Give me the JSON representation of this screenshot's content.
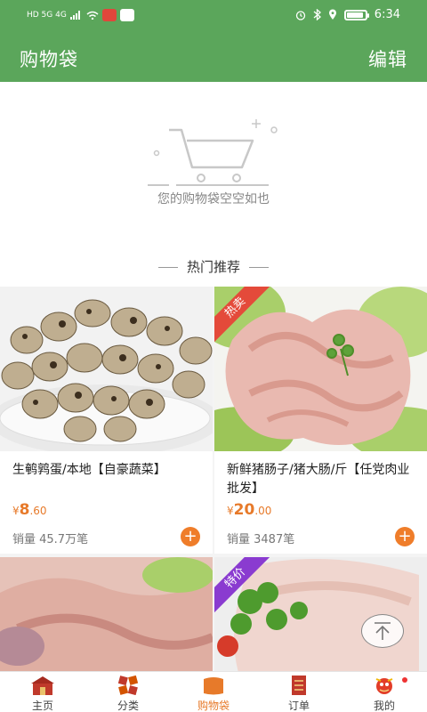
{
  "status_bar": {
    "left_text": "HD 5G 4G",
    "time": "6:34"
  },
  "header": {
    "title": "购物袋",
    "edit_label": "编辑"
  },
  "empty_cart": {
    "message": "您的购物袋空空如也"
  },
  "recommend": {
    "title": "热门推荐"
  },
  "products": [
    {
      "name": "生鹌鹑蛋/本地【自豪蔬菜】",
      "price_symbol": "¥",
      "price_int": "8",
      "price_dec": ".60",
      "sales": "销量 45.7万笔",
      "badge": "",
      "image": "quail-eggs"
    },
    {
      "name": "新鲜猪肠子/猪大肠/斤【任党肉业批发】",
      "price_symbol": "¥",
      "price_int": "20",
      "price_dec": ".00",
      "sales": "销量 3487笔",
      "badge": "热卖",
      "image": "pork-intestine"
    },
    {
      "name": "",
      "badge": "",
      "image": "pork-meat"
    },
    {
      "name": "",
      "badge": "特价",
      "image": "pork-belly"
    }
  ],
  "bottom_nav": [
    {
      "label": "主页",
      "icon": "home-icon"
    },
    {
      "label": "分类",
      "icon": "category-icon"
    },
    {
      "label": "购物袋",
      "icon": "bag-icon"
    },
    {
      "label": "订单",
      "icon": "order-icon"
    },
    {
      "label": "我的",
      "icon": "profile-icon"
    }
  ],
  "colors": {
    "brand_green": "#5ba65b",
    "price_orange": "#e77a2a",
    "hot_red": "#e44a3a",
    "sale_purple": "#8a3bd0"
  }
}
